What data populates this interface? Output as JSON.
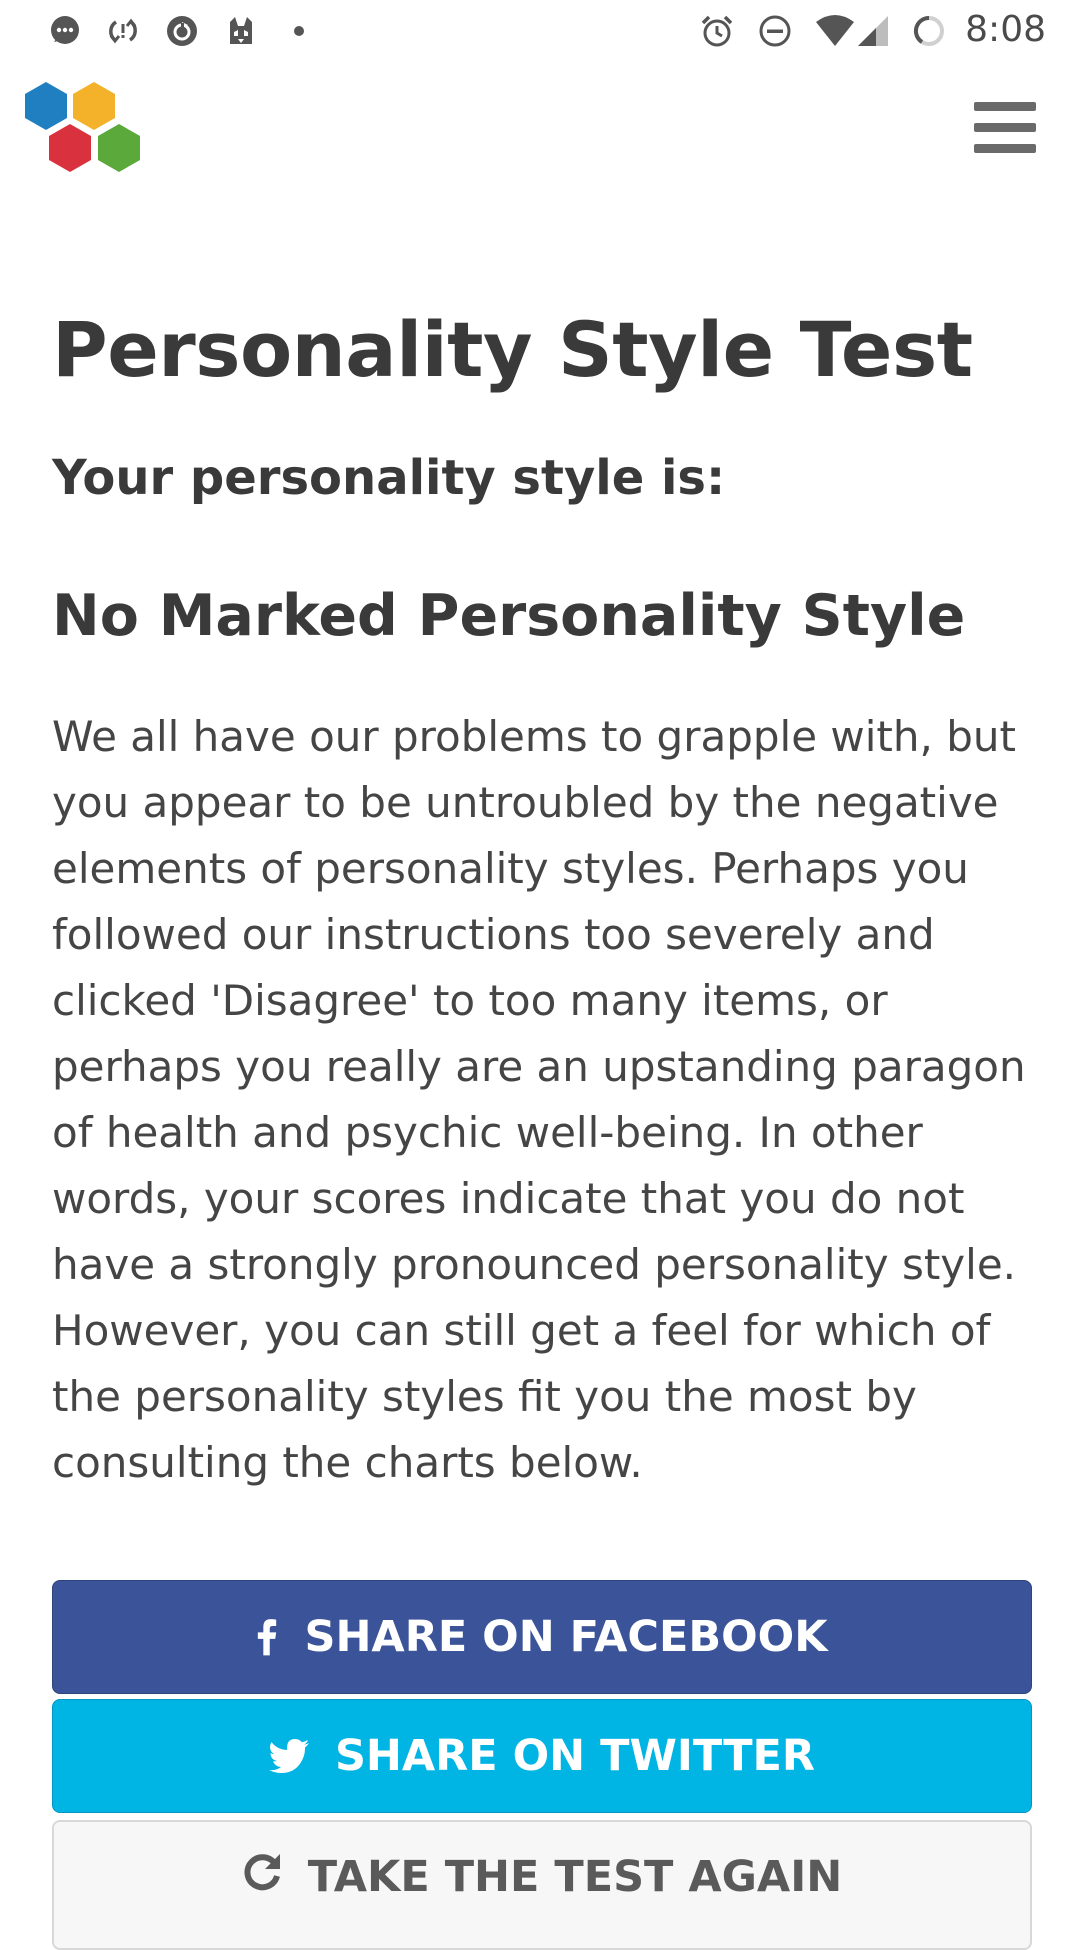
{
  "status_bar": {
    "time": "8:08",
    "left_icons": [
      "chat-bubble-icon",
      "sync-icon",
      "refresh-circle-icon",
      "husky-app-icon",
      "dot-icon"
    ],
    "right_icons": [
      "alarm-icon",
      "do-not-disturb-icon",
      "wifi-icon",
      "signal-icon",
      "battery-charging-icon"
    ]
  },
  "header": {
    "logo": "hexagon-logo",
    "menu_icon": "hamburger-menu-icon"
  },
  "main": {
    "title": "Personality Style Test",
    "subtitle": "Your personality style is:",
    "result": "No Marked Personality Style",
    "description": "We all have our problems to grapple with, but you appear to be untroubled by the negative elements of personality styles. Perhaps you followed our instructions too severely and clicked 'Disagree' to too many items, or perhaps you really are an upstanding paragon of health and psychic well-being. In other words, your scores indicate that you do not have a strongly pronounced personality style. However, you can still get a feel for which of the personality styles fit you the most by consulting the charts below."
  },
  "buttons": {
    "facebook": "SHARE ON FACEBOOK",
    "twitter": "SHARE ON TWITTER",
    "retake": "TAKE THE TEST AGAIN"
  },
  "colors": {
    "facebook": "#3b5398",
    "twitter": "#00b4e3",
    "retake_bg": "#f7f7f7",
    "text": "#3f3f3f",
    "logo_blue": "#1f7fc1",
    "logo_yellow": "#f3b229",
    "logo_red": "#d9313d",
    "logo_green": "#5ba83b"
  }
}
